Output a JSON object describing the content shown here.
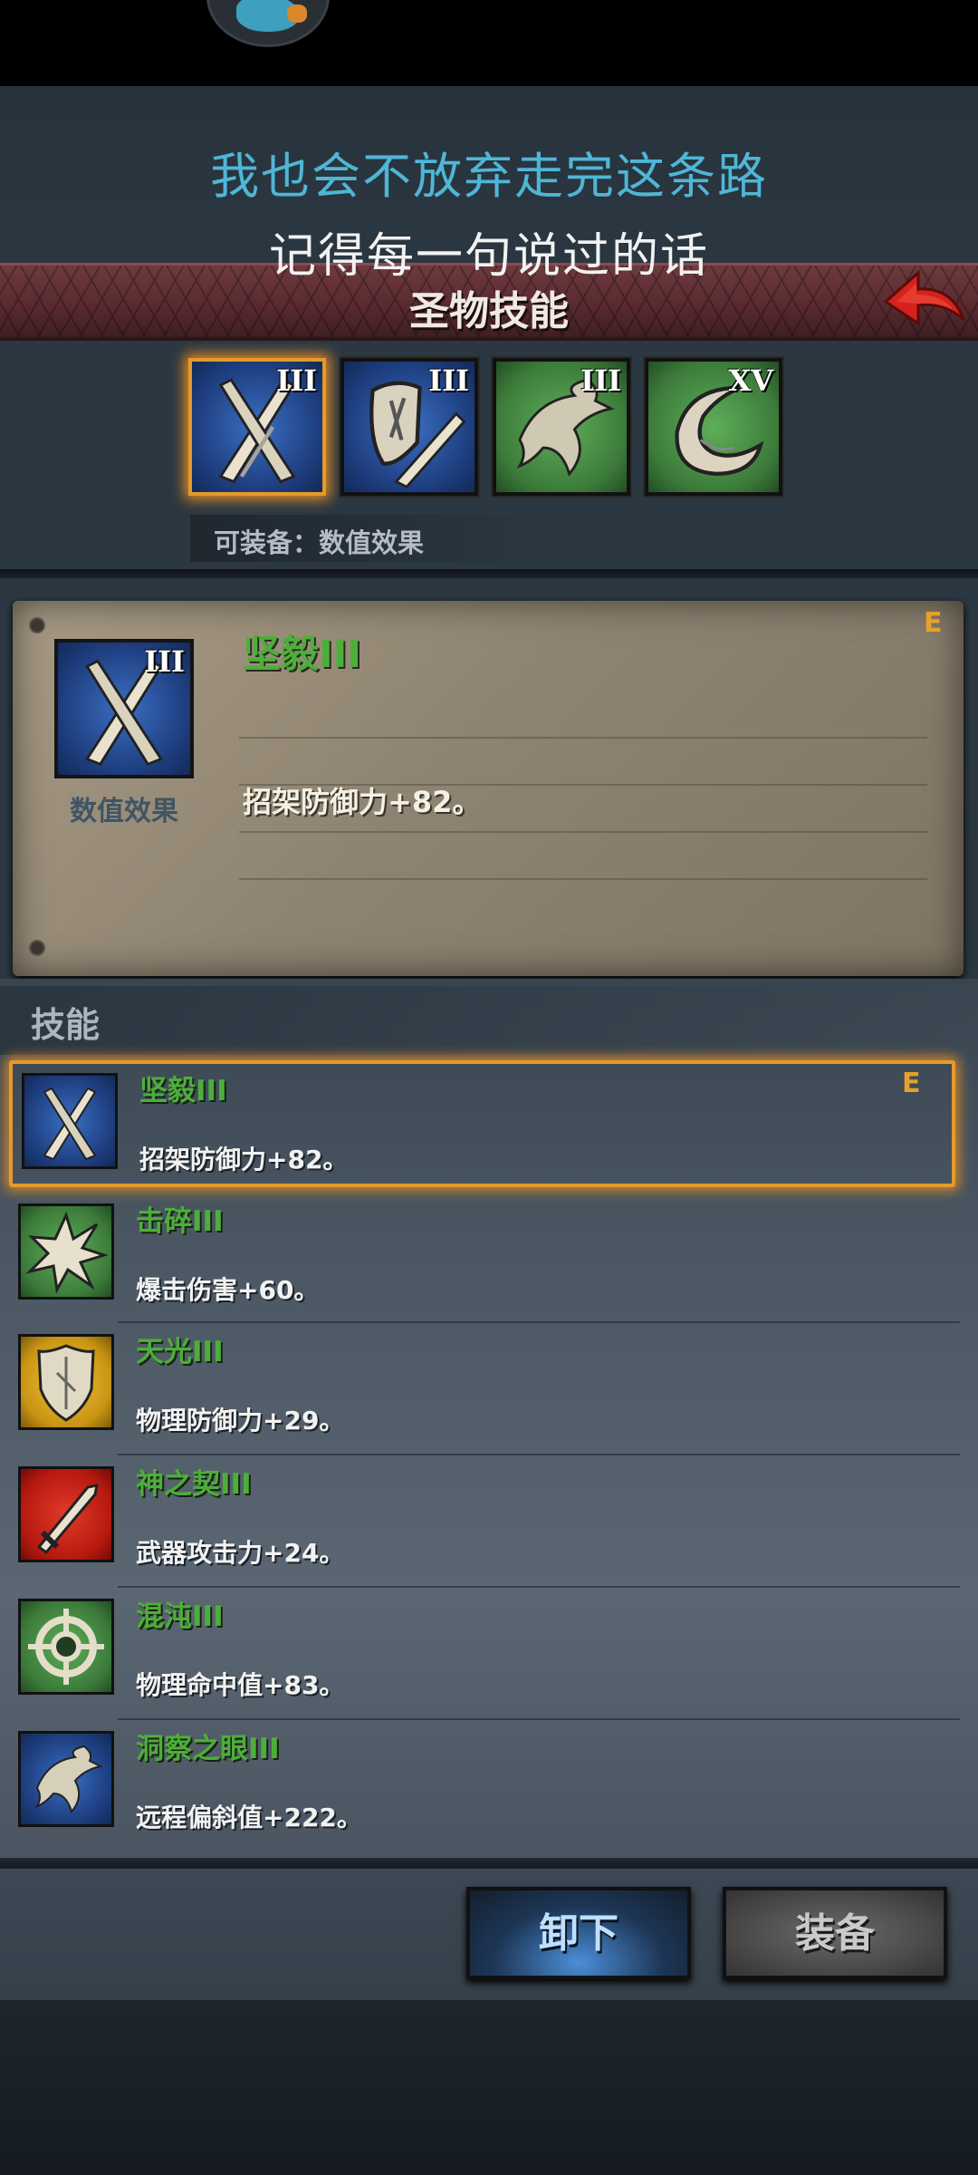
{
  "captions": {
    "line1": "我也会不放弃走完这条路",
    "line2": "记得每一句说过的话"
  },
  "header": {
    "title": "圣物技能",
    "back_icon": "back-arrow-icon"
  },
  "relic_slots": [
    {
      "icon": "crossed-swords-icon",
      "rank": "III",
      "color": "#2a58a8",
      "selected": true
    },
    {
      "icon": "shield-sword-icon",
      "rank": "III",
      "color": "#2a58a8",
      "selected": false
    },
    {
      "icon": "eagle-icon",
      "rank": "III",
      "color": "#3c7b3a",
      "selected": false
    },
    {
      "icon": "horn-icon",
      "rank": "XV",
      "color": "#3c7b3a",
      "selected": false
    }
  ],
  "equip_hint": "可装备：数值效果",
  "detail": {
    "rank": "III",
    "type_label": "数值效果",
    "name": "坚毅III",
    "effect": "招架防御力+82。",
    "equipped_mark": "E"
  },
  "skills": {
    "heading": "技能",
    "items": [
      {
        "name": "坚毅III",
        "effect": "招架防御力+82。",
        "icon": "crossed-swords-icon",
        "bg": "blue",
        "selected": true,
        "equipped_mark": "E"
      },
      {
        "name": "击碎III",
        "effect": "爆击伤害+60。",
        "icon": "burst-icon",
        "bg": "green",
        "selected": false,
        "equipped_mark": ""
      },
      {
        "name": "天光III",
        "effect": "物理防御力+29。",
        "icon": "shield-icon",
        "bg": "gold",
        "selected": false,
        "equipped_mark": ""
      },
      {
        "name": "神之契III",
        "effect": "武器攻击力+24。",
        "icon": "sword-icon",
        "bg": "red",
        "selected": false,
        "equipped_mark": ""
      },
      {
        "name": "混沌III",
        "effect": "物理命中值+83。",
        "icon": "crosshair-icon",
        "bg": "green",
        "selected": false,
        "equipped_mark": ""
      },
      {
        "name": "洞察之眼III",
        "effect": "远程偏斜值+222。",
        "icon": "eagle-icon",
        "bg": "blue",
        "selected": false,
        "equipped_mark": ""
      }
    ]
  },
  "buttons": {
    "unequip": "卸下",
    "equip": "装备"
  },
  "colors": {
    "skill_name": "#4caf3a",
    "selection_glow": "#e59a2a",
    "caption_blue": "#4fb6d6",
    "banner": "#57292e"
  }
}
